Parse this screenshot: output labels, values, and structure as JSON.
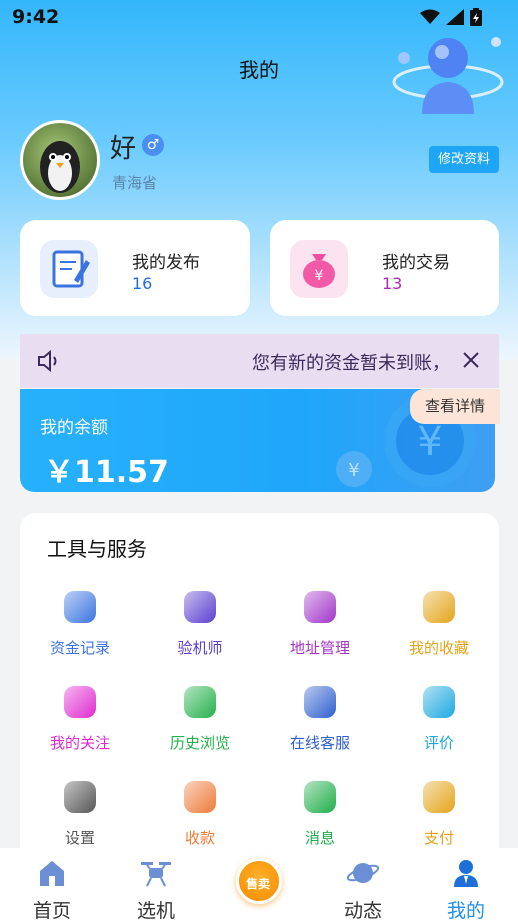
{
  "status_bar": {
    "time": "9:42"
  },
  "header": {
    "title": "我的"
  },
  "profile": {
    "name": "好",
    "gender_symbol": "♂",
    "province": "青海省",
    "edit_label": "修改资料"
  },
  "stats": [
    {
      "label": "我的发布",
      "value": "16",
      "color": "#1e6fd8"
    },
    {
      "label": "我的交易",
      "value": "13",
      "color": "#b02ab8"
    }
  ],
  "notice": {
    "text": "您有新的资金暂未到账，"
  },
  "balance": {
    "label": "我的余额",
    "amount": "￥11.57",
    "detail_label": "查看详情"
  },
  "tools": {
    "title": "工具与服务",
    "items": [
      {
        "label": "资金记录",
        "icon": "wallet-record-icon",
        "color": "#3b74e0"
      },
      {
        "label": "验机师",
        "icon": "cube-icon",
        "color": "#5a3fcf"
      },
      {
        "label": "地址管理",
        "icon": "address-icon",
        "color": "#a235c9"
      },
      {
        "label": "我的收藏",
        "icon": "favorite-icon",
        "color": "#e3a41a"
      },
      {
        "label": "我的关注",
        "icon": "follow-icon",
        "color": "#e02ad0"
      },
      {
        "label": "历史浏览",
        "icon": "history-icon",
        "color": "#24b04a"
      },
      {
        "label": "在线客服",
        "icon": "service-icon",
        "color": "#2f5fd0"
      },
      {
        "label": "评价",
        "icon": "review-icon",
        "color": "#1ba8e0"
      },
      {
        "label": "设置",
        "icon": "settings-icon",
        "color": "#555555"
      },
      {
        "label": "收款",
        "icon": "receive-icon",
        "color": "#ee7a3a"
      },
      {
        "label": "消息",
        "icon": "message-icon",
        "color": "#1fae4a"
      },
      {
        "label": "支付",
        "icon": "pay-icon",
        "color": "#e3a41a"
      }
    ]
  },
  "tabbar": {
    "items": [
      {
        "label": "首页",
        "icon": "home-icon"
      },
      {
        "label": "选机",
        "icon": "drone-icon"
      },
      {
        "label": "动态",
        "icon": "planet-icon"
      },
      {
        "label": "我的",
        "icon": "profile-icon"
      }
    ],
    "center_label": "售卖",
    "active": "我的",
    "active_color": "#1e90f0"
  }
}
